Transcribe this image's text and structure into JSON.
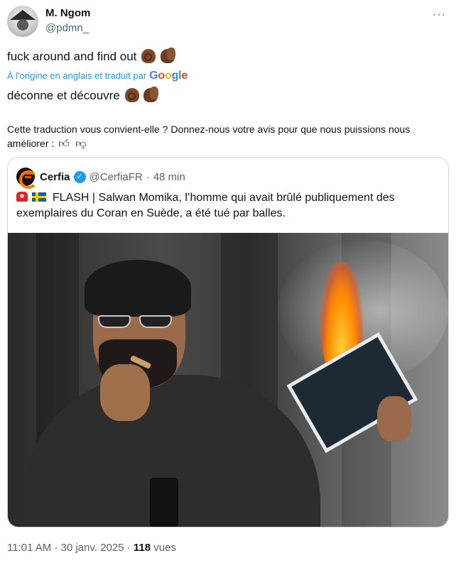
{
  "author": {
    "name": "M. Ngom",
    "handle": "@pdmn_"
  },
  "more_icon": "more-horizontal-icon",
  "tweet": {
    "text": "fuck around and find out",
    "translated_label": "À l'origine en anglais et traduit par",
    "translated_provider": "Google",
    "translation": "déconne et découvre",
    "emojis": [
      "ok-hand-dark",
      "clapping-hands-dark"
    ]
  },
  "feedback": {
    "text": "Cette traduction vous convient-elle ? Donnez-nous votre avis pour que nous puissions nous améliorer :",
    "icons": [
      "thumbs-up-icon",
      "thumbs-down-icon"
    ]
  },
  "quote": {
    "name": "Cerfia",
    "handle": "@CerfiaFR",
    "separator": "·",
    "time": "48 min",
    "text": "FLASH | Salwan Momika, l’homme qui avait brûlé publiquement des exemplaires du Coran en Suède, a été tué par balles.",
    "icons": [
      "police-siren-icon",
      "sweden-flag-icon",
      "verified-badge-icon"
    ]
  },
  "meta": {
    "time": "11:01 AM",
    "separator": "·",
    "date": "30 janv. 2025",
    "views_count": "118",
    "views_label": "vues"
  },
  "colors": {
    "accent": "#1d9bf0",
    "muted": "#536471",
    "text": "#0f1419",
    "border": "#cfd9de"
  }
}
